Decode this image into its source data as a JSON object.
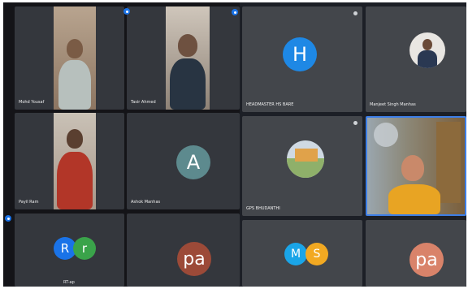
{
  "left_screen": {
    "tiles": [
      {
        "name": "Mohd Yousaf",
        "type": "video"
      },
      {
        "name": "Tasir Ahmed",
        "type": "video"
      },
      {
        "name": "Payil Ram",
        "type": "video"
      },
      {
        "name": "Ashok Manhas",
        "type": "avatar",
        "initial": "A",
        "color": "#5d8a8e"
      },
      {
        "name": "RT-ap",
        "type": "multi_avatar",
        "initials": [
          "R",
          "r"
        ],
        "colors": [
          "#1a73e8",
          "#3aa34a"
        ]
      },
      {
        "name": "",
        "type": "avatar",
        "initial": "pa",
        "color": "#9c4a38"
      }
    ]
  },
  "right_screen": {
    "tiles": [
      {
        "name": "HEADMASTER HS BARE",
        "type": "avatar",
        "initial": "H",
        "color": "#1e88e5"
      },
      {
        "name": "Manjeet Singh Manhas",
        "type": "photo_avatar"
      },
      {
        "name": "GPS BHUDANTHI",
        "type": "photo_avatar"
      },
      {
        "name": "",
        "type": "video"
      },
      {
        "name": "",
        "type": "multi_avatar",
        "initials": [
          "M",
          "S"
        ],
        "colors": [
          "#1aa5e8",
          "#f2a922"
        ]
      },
      {
        "name": "",
        "type": "avatar",
        "initial": "pa",
        "color": "#d9836a"
      }
    ]
  },
  "icons": {
    "corner_badge": "more-options-icon",
    "pin": "pin-icon"
  }
}
